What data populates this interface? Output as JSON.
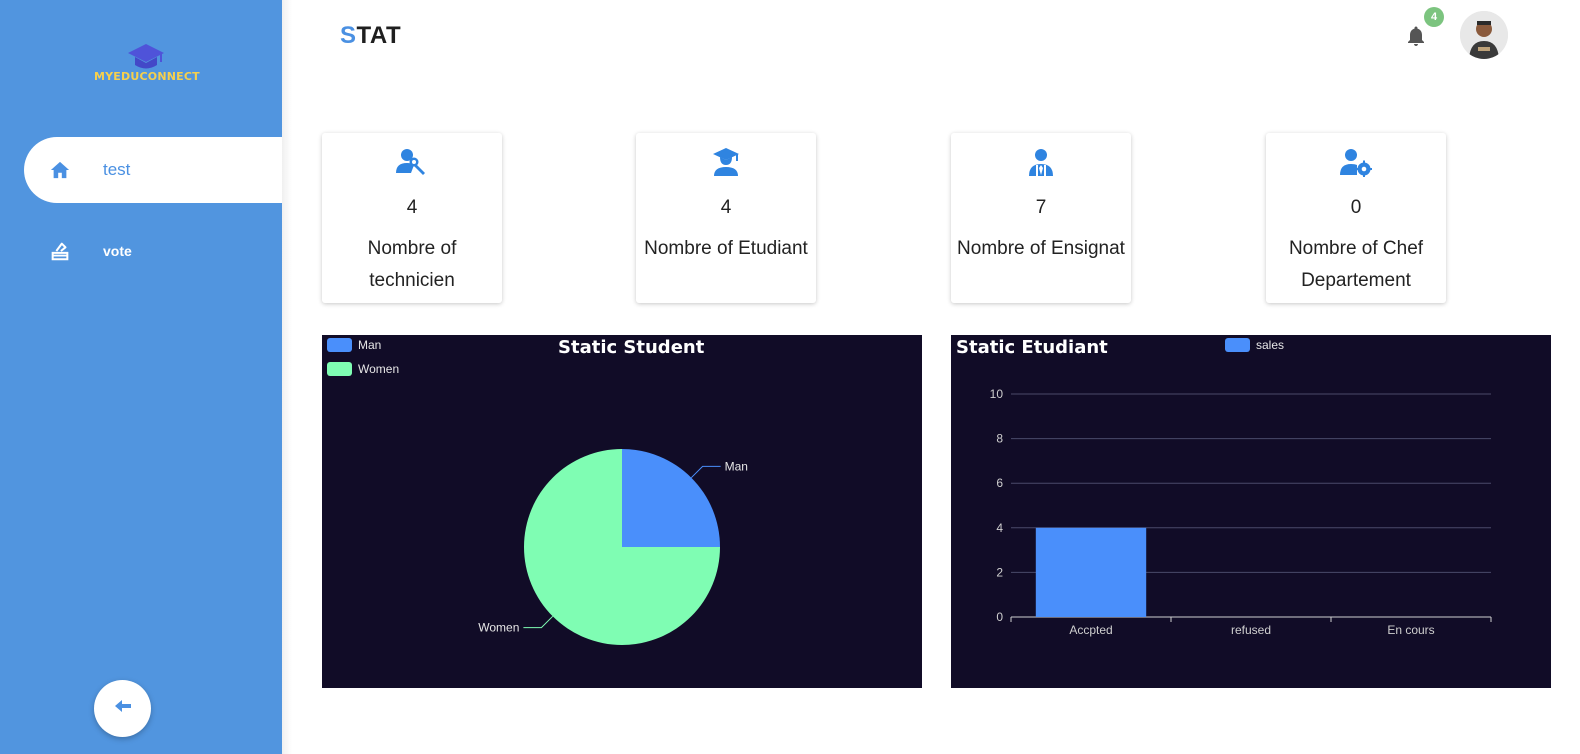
{
  "app": {
    "brand": "MYEDUCONNECT",
    "page_title_first": "S",
    "page_title_rest": "TAT"
  },
  "sidebar": {
    "items": [
      {
        "label": "test",
        "icon": "home-icon",
        "active": true
      },
      {
        "label": "vote",
        "icon": "ballot-box-icon",
        "active": false
      }
    ],
    "back_icon": "arrow-left-icon"
  },
  "header": {
    "notifications_count": "4",
    "bell_icon": "bell-icon",
    "avatar": "user-avatar"
  },
  "stats": [
    {
      "icon": "technician-icon",
      "value": "4",
      "label": "Nombre of technicien"
    },
    {
      "icon": "student-icon",
      "value": "4",
      "label": "Nombre of Etudiant"
    },
    {
      "icon": "teacher-icon",
      "value": "7",
      "label": "Nombre of Ensignat"
    },
    {
      "icon": "user-settings-icon",
      "value": "0",
      "label": "Nombre of Chef Departement"
    }
  ],
  "colors": {
    "sidebar": "#5195df",
    "accent": "#4a90e2",
    "chart_bg": "#110c27",
    "series_blue": "#4a8ffb",
    "series_green": "#7ffdb3",
    "badge": "#7cc47f"
  },
  "chart_data": [
    {
      "type": "pie",
      "title": "Static Student",
      "legend": [
        "Man",
        "Women"
      ],
      "legend_position": "top-left",
      "slices": [
        {
          "label": "Man",
          "value": 1,
          "color": "#4a8ffb"
        },
        {
          "label": "Women",
          "value": 3,
          "color": "#7ffdb3"
        }
      ]
    },
    {
      "type": "bar",
      "title": "Static Etudiant",
      "legend_position": "top",
      "categories": [
        "Accpted",
        "refused",
        "En cours"
      ],
      "series": [
        {
          "name": "sales",
          "values": [
            4,
            0,
            0
          ],
          "color": "#4a8ffb"
        }
      ],
      "ylim": [
        0,
        10
      ],
      "yticks": [
        "0",
        "2",
        "4",
        "6",
        "8",
        "10"
      ],
      "grid": true
    }
  ]
}
